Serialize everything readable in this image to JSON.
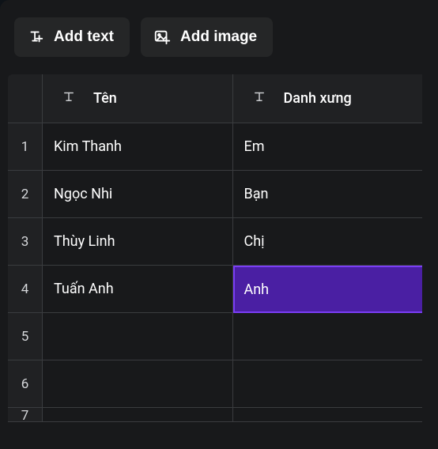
{
  "toolbar": {
    "add_text_label": "Add text",
    "add_image_label": "Add image"
  },
  "table": {
    "columns": [
      {
        "label": "Tên"
      },
      {
        "label": "Danh xưng"
      }
    ],
    "rows": [
      {
        "num": "1",
        "cells": [
          "Kim Thanh",
          "Em"
        ]
      },
      {
        "num": "2",
        "cells": [
          "Ngọc Nhi",
          "Bạn"
        ]
      },
      {
        "num": "3",
        "cells": [
          "Thùy Linh",
          "Chị"
        ]
      },
      {
        "num": "4",
        "cells": [
          "Tuấn Anh",
          "Anh"
        ]
      },
      {
        "num": "5",
        "cells": [
          "",
          ""
        ]
      },
      {
        "num": "6",
        "cells": [
          "",
          ""
        ]
      },
      {
        "num": "7",
        "cells": [
          "",
          ""
        ]
      }
    ],
    "selected": {
      "row": 3,
      "col": 1
    }
  }
}
